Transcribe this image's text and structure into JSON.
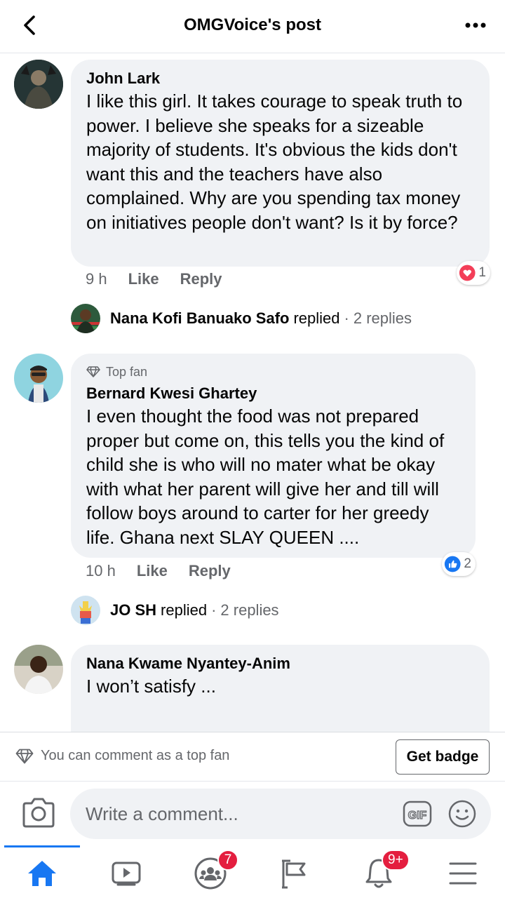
{
  "header": {
    "title": "OMGVoice's post",
    "back_icon": "chevron-left-icon",
    "more_icon": "more-dots-icon"
  },
  "comments": [
    {
      "author": "John Lark",
      "text": "I like this girl. It takes courage to speak truth to power. I believe she speaks for a sizeable majority of students. It's obvious the kids don't want this and the teachers have also complained. Why are you spending tax money on initiatives people don't want? Is it by force?",
      "time": "9 h",
      "like_label": "Like",
      "reply_label": "Reply",
      "reaction": {
        "icon": "heart-reaction-icon",
        "count": "1",
        "color": "#f33e58"
      },
      "replies": {
        "name": "Nana Kofi Banuako Safo",
        "action": "replied",
        "count": "2 replies"
      }
    },
    {
      "badge": "Top fan",
      "author": "Bernard Kwesi Ghartey",
      "text": "I even thought the food was not prepared proper but come on, this tells you the kind of child she is who will no mater what be okay with what her parent will give her and till will follow boys around to carter for her greedy life. Ghana next SLAY QUEEN ....",
      "time": "10 h",
      "like_label": "Like",
      "reply_label": "Reply",
      "reaction": {
        "icon": "like-reaction-icon",
        "count": "2",
        "color": "#1877f2"
      },
      "replies": {
        "name": "JO SH",
        "action": "replied",
        "count": "2 replies"
      }
    },
    {
      "author": "Nana Kwame Nyantey-Anim",
      "text": "I won’t satisfy ..."
    }
  ],
  "topfan_bar": {
    "note": "You can comment as a top fan",
    "button": "Get badge"
  },
  "composer": {
    "placeholder": "Write a comment..."
  },
  "nav": {
    "items": [
      {
        "name": "home",
        "icon": "home-icon",
        "active": true
      },
      {
        "name": "watch",
        "icon": "video-icon"
      },
      {
        "name": "groups",
        "icon": "groups-icon",
        "badge": "7"
      },
      {
        "name": "pages",
        "icon": "flag-icon"
      },
      {
        "name": "notifications",
        "icon": "bell-icon",
        "badge": "9+"
      },
      {
        "name": "menu",
        "icon": "menu-icon"
      }
    ]
  },
  "colors": {
    "accent": "#1877f2",
    "bubble": "#f0f2f5",
    "secondary_text": "#65676b",
    "badge_red": "#e41e3f"
  }
}
